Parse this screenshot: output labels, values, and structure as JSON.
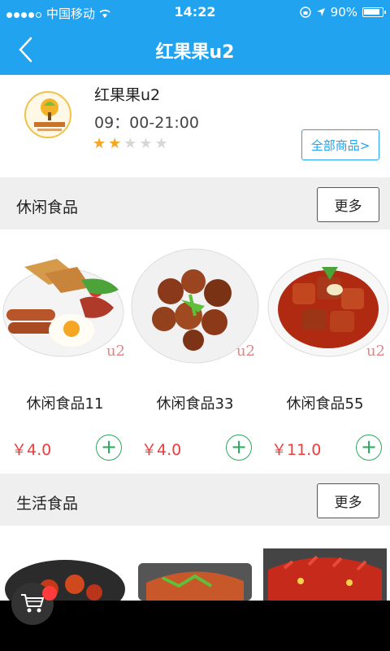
{
  "status_bar": {
    "carrier": "中国移动",
    "time": "14:22",
    "battery": "90%"
  },
  "nav": {
    "title": "红果果u2",
    "back_icon": "chevron-left-icon"
  },
  "store": {
    "name": "红果果u2",
    "hours": "09：00-21:00",
    "rating": 2,
    "rating_max": 5,
    "all_products_label": "全部商品>"
  },
  "sections": [
    {
      "title": "休闲食品",
      "more_label": "更多",
      "products": [
        {
          "name": "休闲食品11",
          "price": "￥4.0",
          "watermark": "u2"
        },
        {
          "name": "休闲食品33",
          "price": "￥4.0",
          "watermark": "u2"
        },
        {
          "name": "休闲食品55",
          "price": "￥11.0",
          "watermark": "u2"
        }
      ]
    },
    {
      "title": "生活食品",
      "more_label": "更多"
    }
  ],
  "colors": {
    "accent": "#22a3f0",
    "price": "#ef3b3b",
    "add": "#2aa85a"
  },
  "icons": {
    "cart": "shopping-cart-icon",
    "add": "plus-circle-icon"
  }
}
